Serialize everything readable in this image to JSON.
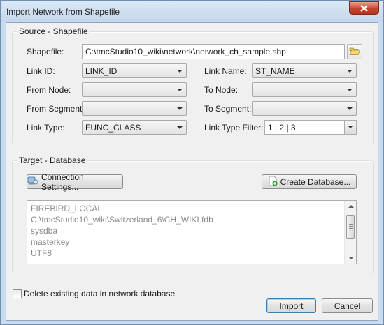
{
  "window": {
    "title": "Import Network from Shapefile",
    "close_icon": "close-x-icon"
  },
  "source": {
    "title": "Source - Shapefile",
    "shapefile_label": "Shapefile:",
    "shapefile_value": "C:\\tmcStudio10_wiki\\network\\network_ch_sample.shp",
    "link_id_label": "Link ID:",
    "link_id_value": "LINK_ID",
    "link_name_label": "Link Name:",
    "link_name_value": "ST_NAME",
    "from_node_label": "From Node:",
    "from_node_value": "",
    "to_node_label": "To Node:",
    "to_node_value": "",
    "from_segment_label": "From Segment:",
    "from_segment_value": "",
    "to_segment_label": "To Segment:",
    "to_segment_value": "",
    "link_type_label": "Link Type:",
    "link_type_value": "FUNC_CLASS",
    "link_type_filter_label": "Link Type Filter:",
    "link_type_filter_value": "1 | 2 | 3"
  },
  "target": {
    "title": "Target - Database",
    "connection_settings_label": "Connection Settings...",
    "create_database_label": "Create Database...",
    "connection_lines": [
      "FIREBIRD_LOCAL",
      "C:\\tmcStudio10_wiki\\Switzerland_6\\CH_WIKI.fdb",
      "sysdba",
      "masterkey",
      "UTF8"
    ]
  },
  "delete_existing_label": "Delete existing data in network database",
  "import_label": "Import",
  "cancel_label": "Cancel"
}
